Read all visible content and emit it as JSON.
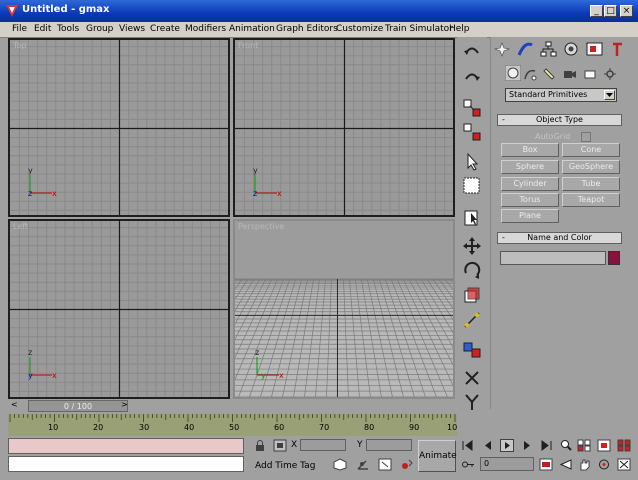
{
  "window": {
    "title": "Untitled - gmax",
    "minimize_glyph": "_",
    "restore_glyph": "□",
    "close_glyph": "×"
  },
  "menu": [
    "File",
    "Edit",
    "Tools",
    "Group",
    "Views",
    "Create",
    "Modifiers",
    "Animation",
    "Graph Editors",
    "Customize",
    "Train Simulator",
    "Help"
  ],
  "viewports": {
    "top": {
      "label": "Top",
      "axis_y": "y",
      "axis_z": "z",
      "axis_x": "x"
    },
    "front": {
      "label": "Front",
      "axis_y": "y",
      "axis_z": "z",
      "axis_x": "x"
    },
    "left": {
      "label": "Left",
      "axis_y": "z",
      "axis_z": "y",
      "axis_x": "x"
    },
    "perspective": {
      "label": "Perspective",
      "axis_y": "z",
      "axis_z": "y",
      "axis_x": "x"
    }
  },
  "command_panel": {
    "tabs": [
      "create-icon",
      "modify-icon",
      "hierarchy-icon",
      "motion-icon",
      "display-icon",
      "utilities-icon"
    ],
    "subtabs": [
      "geometry-icon",
      "shapes-icon",
      "lights-icon",
      "cameras-icon",
      "helpers-icon",
      "systems-icon"
    ],
    "category": "Standard Primitives",
    "object_type_title": "Object Type",
    "autogrid_label": "AutoGrid",
    "buttons": [
      "Box",
      "Cone",
      "Sphere",
      "GeoSphere",
      "Cylinder",
      "Tube",
      "Torus",
      "Teapot",
      "Plane"
    ],
    "name_color_title": "Name and Color",
    "rollout_minus": "-",
    "color": "#8b1040"
  },
  "timeline": {
    "slider_text": "0 / 100",
    "left_arrow": "<",
    "right_arrow": ">",
    "ticks": [
      "10",
      "20",
      "30",
      "40",
      "50",
      "60",
      "70",
      "80",
      "90",
      "10"
    ]
  },
  "bottom": {
    "x_label": "X",
    "y_label": "Y",
    "add_time_tag": "Add Time Tag",
    "animate": "Animate",
    "frame_value": "0"
  },
  "colors": {
    "title_bar": "#0a3ab8",
    "viewport_bg": "#9a9a9a",
    "axis_red": "#c00000",
    "axis_green": "#00a000",
    "axis_blue": "#0000c0"
  }
}
